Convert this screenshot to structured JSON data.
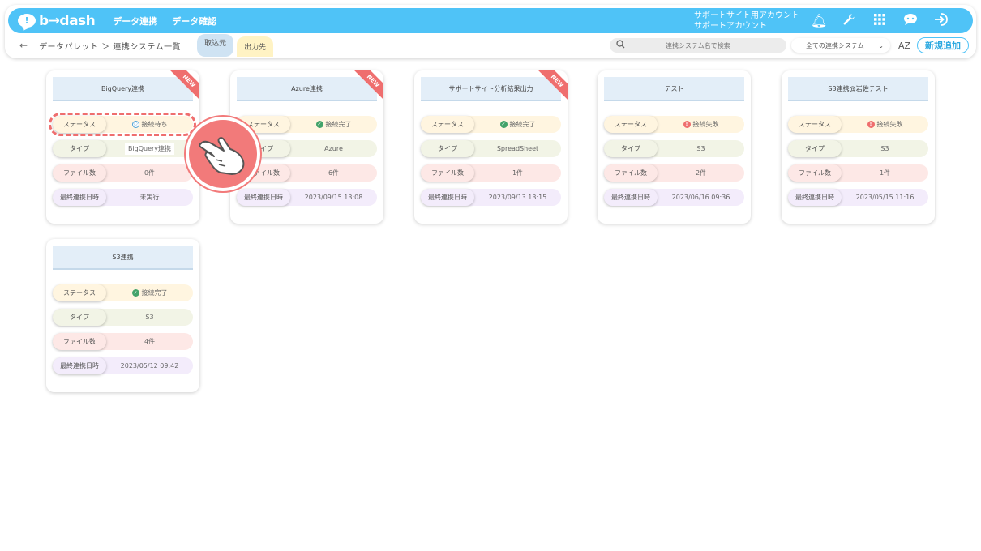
{
  "app": {
    "logo_text": "b→dash",
    "logo_mark": "!",
    "nav": [
      "データ連携",
      "データ確認"
    ],
    "account_line1": "サポートサイト用アカウント",
    "account_line2": "サポートアカウント",
    "icons": [
      "bell-icon",
      "wrench-icon",
      "grid-icon",
      "chat-icon",
      "logout-icon"
    ],
    "accent_color": "#4fc3f7"
  },
  "subbar": {
    "back": "←",
    "breadcrumb": "データパレット ＞ 連携システム一覧",
    "tabs": [
      "取込元",
      "出力先"
    ],
    "search_placeholder": "連携システム名で検索",
    "filter_value": "全ての連携システム",
    "filter_caret": "⌄",
    "sort_label": "AZ",
    "new_button": "新規追加"
  },
  "labels": {
    "status": "ステータス",
    "type": "タイプ",
    "files": "ファイル数",
    "last": "最終連携日時"
  },
  "ribbon_text": "NEW",
  "cards": [
    {
      "title": "BigQuery連携",
      "status": "接続待ち",
      "status_kind": "wait",
      "type": "BigQuery連携",
      "files": "0件",
      "last": "未実行",
      "new": true
    },
    {
      "title": "Azure連携",
      "status": "接続完了",
      "status_kind": "ok",
      "type": "Azure",
      "files": "6件",
      "last": "2023/09/15 13:08",
      "new": true
    },
    {
      "title": "サポートサイト分析結果出力",
      "status": "接続完了",
      "status_kind": "ok",
      "type": "SpreadSheet",
      "files": "1件",
      "last": "2023/09/13 13:15",
      "new": true
    },
    {
      "title": "テスト",
      "status": "接続失敗",
      "status_kind": "ng",
      "type": "S3",
      "files": "2件",
      "last": "2023/06/16 09:36",
      "new": false
    },
    {
      "title": "S3連携@岩佐テスト",
      "status": "接続失敗",
      "status_kind": "ng",
      "type": "S3",
      "files": "1件",
      "last": "2023/05/15 11:16",
      "new": false
    },
    {
      "title": "S3連携",
      "status": "接続完了",
      "status_kind": "ok",
      "type": "S3",
      "files": "4件",
      "last": "2023/05/12 09:42",
      "new": false
    }
  ],
  "status_glyphs": {
    "ok": "✓",
    "ng": "!",
    "wait": "○"
  },
  "status_colors": {
    "ok": "#43a36a",
    "ng": "#ef6e6e",
    "wait": "#4fa3d8"
  }
}
